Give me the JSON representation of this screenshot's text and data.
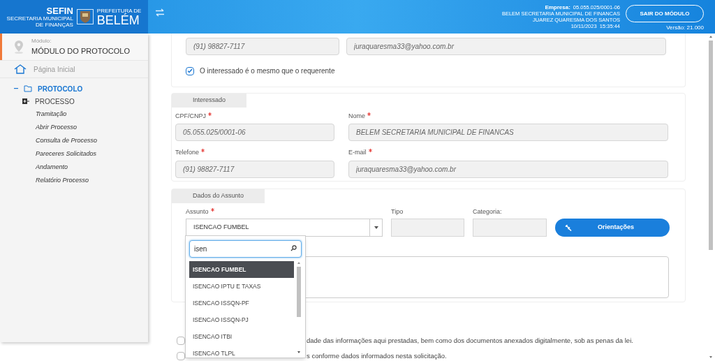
{
  "header": {
    "logo": {
      "title": "SEFIN",
      "subtitle_1": "SECRETARIA MUNICIPAL",
      "subtitle_2": "DE FINANÇAS",
      "prefeitura": "PREFEITURA DE",
      "city": "BELÉM"
    },
    "company_label": "Empresa:",
    "company_id": "05.055.025/0001-06",
    "company_name": "BELEM SECRETARIA MUNICIPAL DE FINANCAS",
    "user": "JUAREZ QUARESMA DOS SANTOS",
    "datetime": "10/11/2023  15:35:44",
    "exit_button": "SAIR DO MÓDULO",
    "version": "Versão: 21.000"
  },
  "sidebar": {
    "module_label": "Módulo:",
    "module_name": "MÓDULO DO PROTOCOLO",
    "home": "Página Inicial",
    "tree": [
      {
        "label": "PROTOCOLO",
        "kind": "folder",
        "children": [
          {
            "label": "PROCESSO",
            "kind": "group",
            "children": [
              {
                "label": "Tramitação",
                "kind": "link"
              },
              {
                "label": "Abrir Processo",
                "kind": "link"
              },
              {
                "label": "Consulta de Processo",
                "kind": "link"
              },
              {
                "label": "Pareceres Solicitados",
                "kind": "link"
              },
              {
                "label": "Andamento",
                "kind": "link"
              },
              {
                "label": "Relatório Processo",
                "kind": "link"
              }
            ]
          }
        ]
      }
    ]
  },
  "requester": {
    "phone": "(91) 98827-7117",
    "email": "juraquaresma33@yahoo.com.br",
    "same_checkbox": {
      "label": "O interessado é o mesmo que o requerente",
      "checked": true
    }
  },
  "interested": {
    "legend": "Interessado",
    "fields": [
      {
        "label": "CPF/CNPJ",
        "required": true,
        "value": "05.055.025/0001-06"
      },
      {
        "label": "Nome",
        "required": true,
        "value": "BELEM SECRETARIA MUNICIPAL DE FINANCAS"
      },
      {
        "label": "Telefone",
        "required": true,
        "value": "(91) 98827-7117"
      },
      {
        "label": "E-mail",
        "required": true,
        "value": "juraquaresma33@yahoo.com.br"
      }
    ]
  },
  "subject": {
    "legend": "Dados do Assunto",
    "subject_label": "Assunto",
    "subject_required": true,
    "subject_value": "ISENCAO FUMBEL",
    "type_label": "Tipo",
    "category_label": "Categoria:",
    "guidance_button": "Orientações"
  },
  "dropdown": {
    "search": "isen",
    "options": [
      {
        "label": "ISENCAO FUMBEL",
        "selected": true
      },
      {
        "label": "ISENCAO IPTU E TAXAS",
        "selected": false
      },
      {
        "label": "ISENCAO ISSQN-PF",
        "selected": false
      },
      {
        "label": "ISENCAO ISSQN-PJ",
        "selected": false
      },
      {
        "label": "ISENCAO ITBI",
        "selected": false
      },
      {
        "label": "ISENCAO TLPL",
        "selected": false
      }
    ]
  },
  "declarations": [
    {
      "text": "dade das informações aqui prestadas, bem como dos documentos anexados digitalmente, sob as penas da lei.",
      "checked": false
    },
    {
      "text": "s conforme dados informados nesta solicitação.",
      "checked": false
    }
  ]
}
